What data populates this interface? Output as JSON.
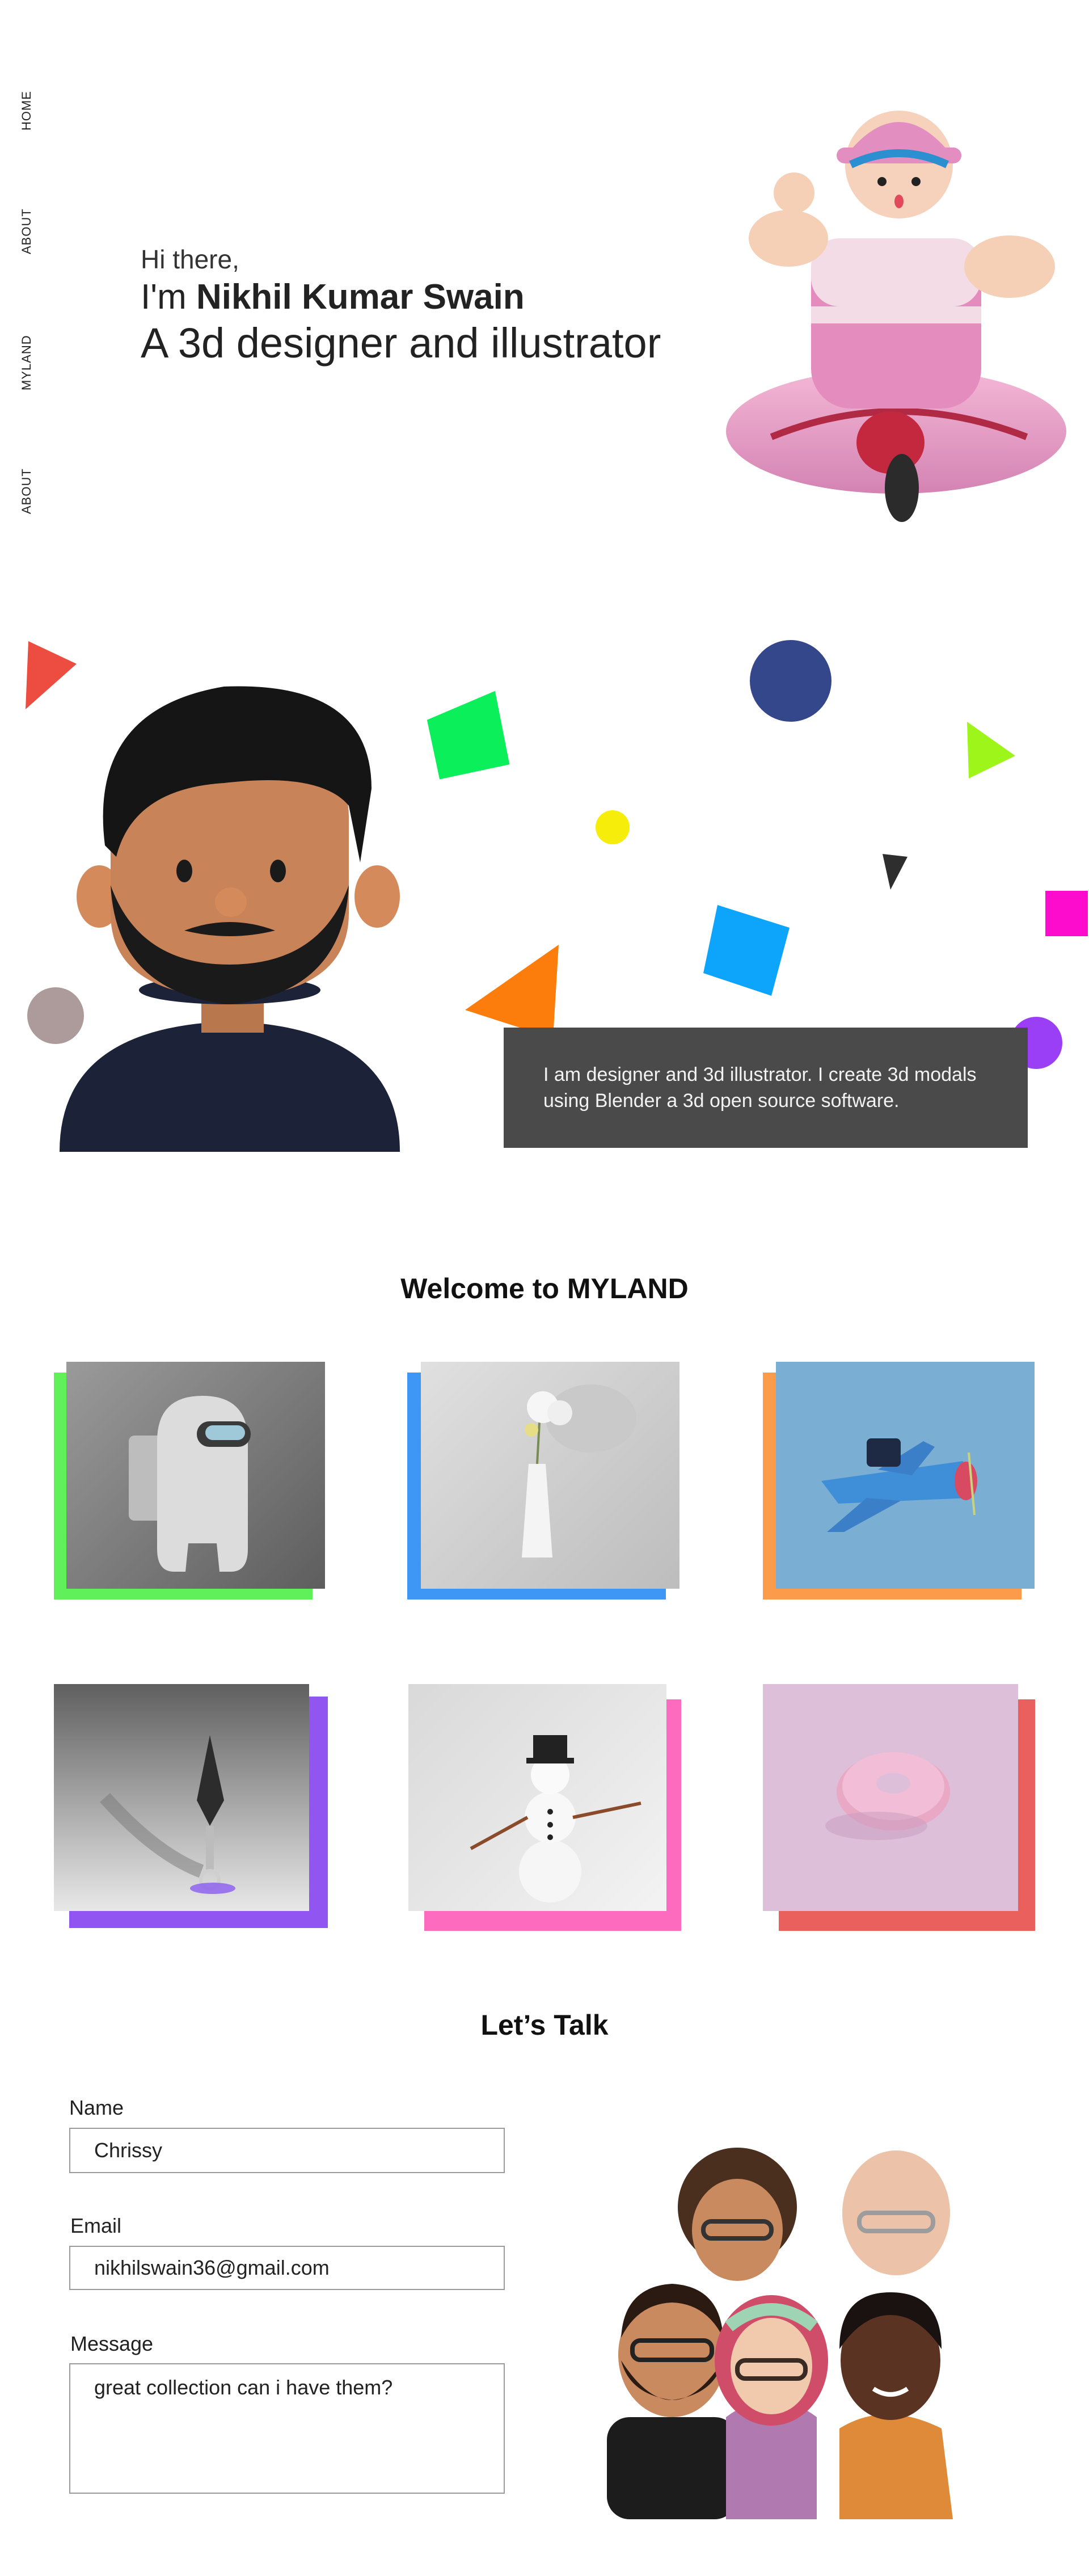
{
  "nav": {
    "items": [
      "HOME",
      "ABOUT",
      "MYLAND",
      "ABOUT"
    ]
  },
  "hero": {
    "greeting": "Hi there,",
    "name_prefix": "I'm ",
    "name": "Nikhil Kumar Swain",
    "role": "A 3d designer and illustrator"
  },
  "about": {
    "text": "I am designer and 3d illustrator. I create 3d modals using Blender a 3d open source software."
  },
  "gallery": {
    "title": "Welcome to MYLAND",
    "items": [
      {
        "name": "among-us-figure",
        "accent": "#5ff05a"
      },
      {
        "name": "flower-vase",
        "accent": "#3f97f5"
      },
      {
        "name": "toy-airplane",
        "accent": "#fc9c4a"
      },
      {
        "name": "kunai",
        "accent": "#9155f2"
      },
      {
        "name": "snowman",
        "accent": "#fc6bbd"
      },
      {
        "name": "donut",
        "accent": "#e9605d"
      }
    ]
  },
  "contact": {
    "title": "Let’s Talk",
    "name_label": "Name",
    "name_value": "Chrissy",
    "email_label": "Email",
    "email_value": "nikhilswain36@gmail.com",
    "message_label": "Message",
    "message_value": "great collection can i have them?"
  },
  "colors": {
    "about_bg": "#4a4a4a",
    "shape_red": "#ec4d40",
    "shape_green": "#0bf05a",
    "shape_navy": "#34478a",
    "shape_lime": "#9ef519",
    "shape_yellow": "#f7ed0a",
    "shape_orange": "#fd7d0c",
    "shape_blue": "#0da4fb",
    "shape_magenta": "#fd0ccd",
    "shape_purple": "#9b3ff6",
    "shape_taupe": "#ad9b9b",
    "shape_dark": "#2e2e2e"
  }
}
